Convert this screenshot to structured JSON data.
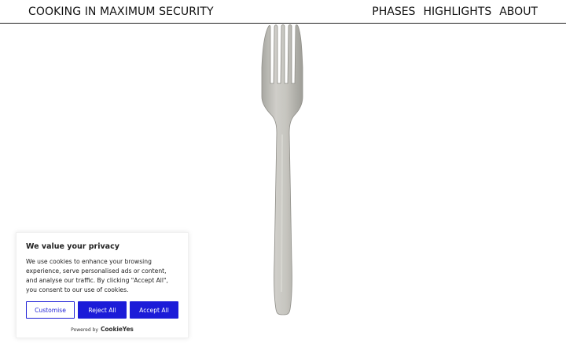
{
  "header": {
    "site_title": "COOKING IN MAXIMUM SECURITY",
    "nav": [
      {
        "label": "PHASES"
      },
      {
        "label": "HIGHLIGHTS"
      },
      {
        "label": "ABOUT"
      }
    ]
  },
  "hero": {
    "image_icon": "fork-icon"
  },
  "cookie_banner": {
    "title": "We value your privacy",
    "text": "We use cookies to enhance your browsing experience, serve personalised ads or content, and analyse our traffic. By clicking \"Accept All\", you consent to our use of cookies.",
    "buttons": {
      "customise": "Customise",
      "reject": "Reject All",
      "accept": "Accept All"
    },
    "powered_by": "Powered by",
    "powered_logo": "CookieYes",
    "accent_color": "#1c1cd8"
  }
}
